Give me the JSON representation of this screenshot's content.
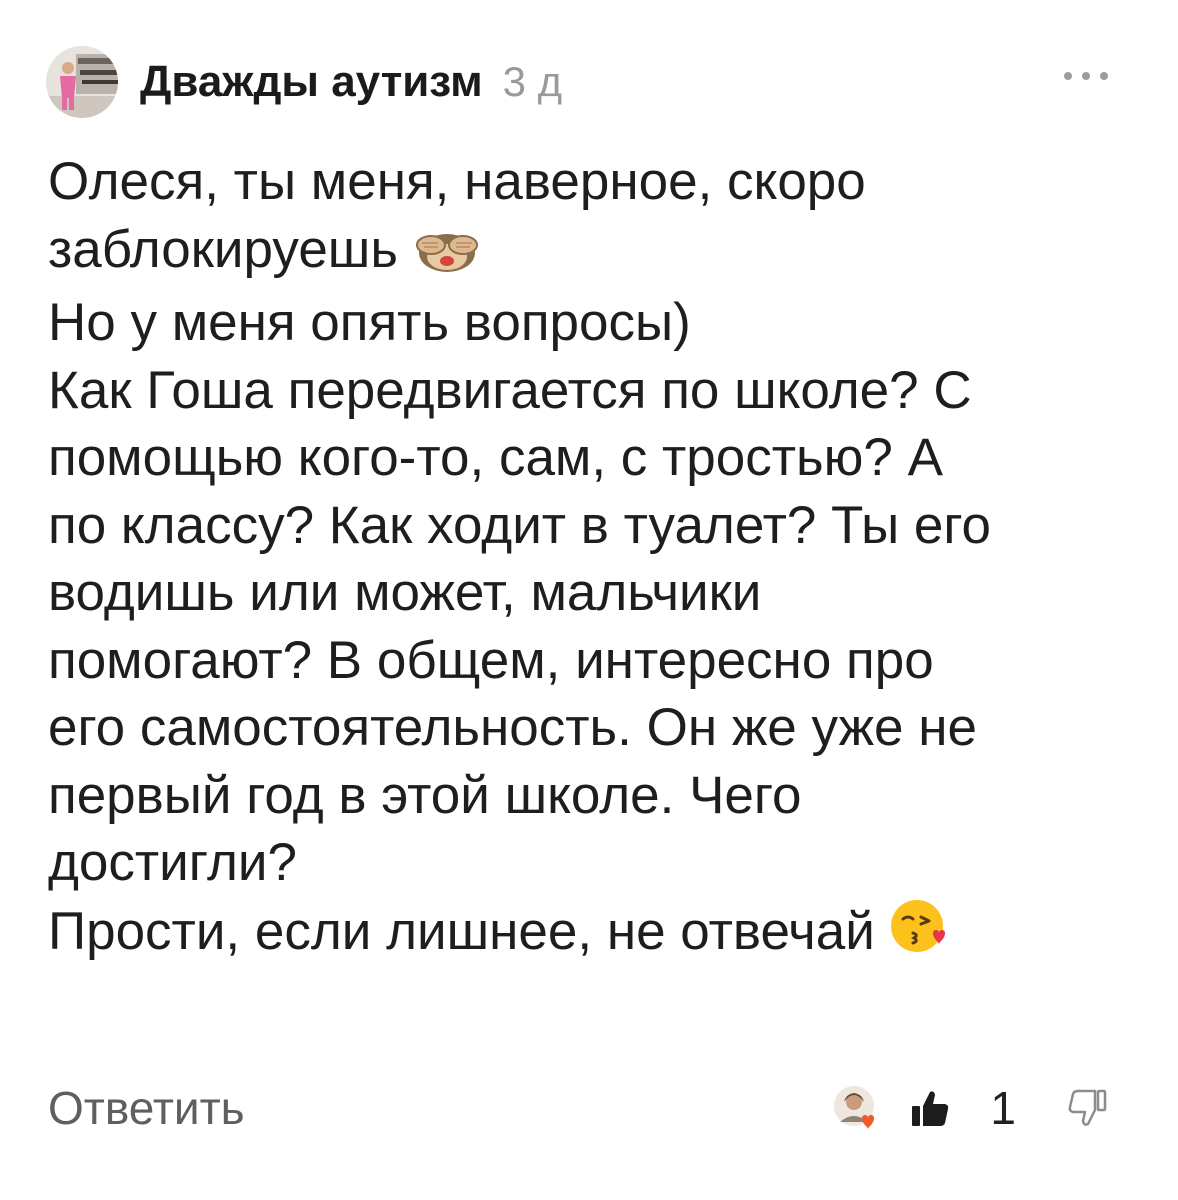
{
  "comment": {
    "author": "Дважды аутизм",
    "time": "3 д",
    "lines": [
      "Олеся, ты меня, наверное, скоро",
      "заблокируешь",
      "Но у меня опять вопросы)",
      "Как Гоша передвигается по школе? С",
      "помощью кого-то, сам, с тростью? А",
      "по классу? Как ходит в туалет? Ты его",
      "водишь или может, мальчики",
      "помогают? В общем, интересно про",
      "его самостоятельность. Он же уже не",
      "первый год в этой школе. Чего",
      "достигли?",
      "Прости, если лишнее, не отвечай"
    ],
    "emojis": {
      "line_2": "see-no-evil-monkey-icon",
      "line_12": "kissing-heart-face-icon"
    }
  },
  "footer": {
    "reply_label": "Ответить",
    "like_count": "1"
  },
  "icons": {
    "more": "more-dots-icon",
    "like": "thumbs-up-icon",
    "dislike": "thumbs-down-icon",
    "liker": "liker-avatar-with-heart"
  },
  "colors": {
    "text": "#1e1e1e",
    "muted": "#9a9a9a",
    "reply": "#5f5f5f",
    "heart": "#f05a28"
  }
}
